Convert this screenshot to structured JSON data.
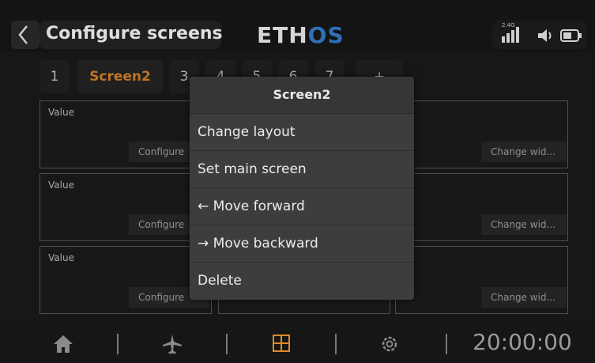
{
  "header": {
    "title": "Configure screens",
    "logo_part1": "ETH",
    "logo_part2": "OS",
    "rssi_label": "2.4G"
  },
  "tabs": [
    "1",
    "Screen2",
    "3",
    "4",
    "5",
    "6",
    "7",
    "+"
  ],
  "active_tab": "Screen2",
  "grid": {
    "value_label": "Value",
    "configure_label": "Configure",
    "change_widget_label": "Change wid..."
  },
  "menu": {
    "title": "Screen2",
    "items": [
      "Change layout",
      "Set main screen",
      "← Move forward",
      "→ Move backward",
      "Delete"
    ]
  },
  "bottom": {
    "icons": [
      "home-icon",
      "airplane-icon",
      "screens-icon",
      "settings-icon"
    ],
    "clock": "20:00:00"
  },
  "colors": {
    "accent": "#e08a2a",
    "logo_blue": "#2f6fb6"
  }
}
